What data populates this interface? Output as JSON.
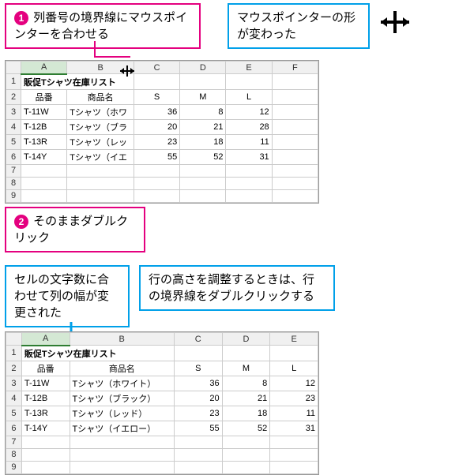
{
  "callouts": {
    "step1": {
      "badge": "1",
      "text": "列番号の境界線にマウスポインターを合わせる"
    },
    "pointer_changed": "マウスポインターの形が変わった",
    "step2": {
      "badge": "2",
      "text": "そのままダブルクリック"
    },
    "width_adjusted": "セルの文字数に合わせて列の幅が変更された",
    "row_hint": "行の高さを調整するときは、行の境界線をダブルクリックする"
  },
  "sheet1": {
    "cols": [
      "A",
      "B",
      "C",
      "D",
      "E",
      "F"
    ],
    "rows": [
      "1",
      "2",
      "3",
      "4",
      "5",
      "6",
      "7",
      "8",
      "9"
    ],
    "title": "販促Tシャツ在庫リスト",
    "headers": {
      "col_a": "品番",
      "col_b": "商品名",
      "col_c": "S",
      "col_d": "M",
      "col_e": "L"
    },
    "data": [
      {
        "a": "T-11W",
        "b": "Tシャツ（ホワ",
        "c": "36",
        "d": "8",
        "e": "12"
      },
      {
        "a": "T-12B",
        "b": "Tシャツ（ブラ",
        "c": "20",
        "d": "21",
        "e": "28"
      },
      {
        "a": "T-13R",
        "b": "Tシャツ（レッ",
        "c": "23",
        "d": "18",
        "e": "11"
      },
      {
        "a": "T-14Y",
        "b": "Tシャツ（イエ",
        "c": "55",
        "d": "52",
        "e": "31"
      }
    ]
  },
  "sheet2": {
    "cols": [
      "A",
      "B",
      "C",
      "D",
      "E"
    ],
    "rows": [
      "1",
      "2",
      "3",
      "4",
      "5",
      "6",
      "7",
      "8",
      "9"
    ],
    "title": "販促Tシャツ在庫リスト",
    "headers": {
      "col_a": "品番",
      "col_b": "商品名",
      "col_c": "S",
      "col_d": "M",
      "col_e": "L"
    },
    "data": [
      {
        "a": "T-11W",
        "b": "Tシャツ（ホワイト）",
        "c": "36",
        "d": "8",
        "e": "12"
      },
      {
        "a": "T-12B",
        "b": "Tシャツ（ブラック）",
        "c": "20",
        "d": "21",
        "e": "23"
      },
      {
        "a": "T-13R",
        "b": "Tシャツ（レッド）",
        "c": "23",
        "d": "18",
        "e": "11"
      },
      {
        "a": "T-14Y",
        "b": "Tシャツ（イエロー）",
        "c": "55",
        "d": "52",
        "e": "31"
      }
    ]
  }
}
